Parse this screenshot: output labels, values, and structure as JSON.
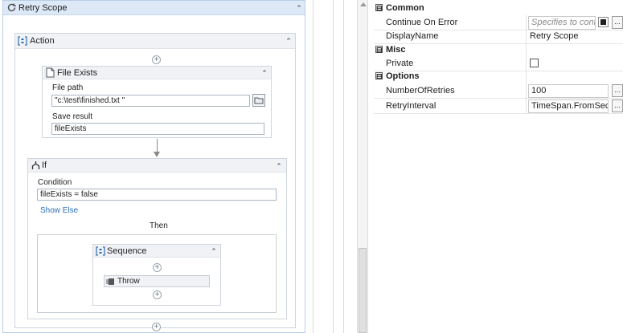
{
  "retry_scope": {
    "title": "Retry Scope",
    "collapse_glyph": "⌃"
  },
  "action": {
    "title": "Action",
    "collapse_glyph": "⌃"
  },
  "file_exists": {
    "title": "File Exists",
    "path_label": "File path",
    "path_value": "\"c:\\test\\finished.txt \"",
    "result_label": "Save result",
    "result_value": "fileExists",
    "collapse_glyph": "⌃"
  },
  "if": {
    "title": "If",
    "condition_label": "Condition",
    "condition_value": "fileExists = false",
    "show_else": "Show Else",
    "then_label": "Then",
    "collapse_glyph": "⌃"
  },
  "sequence": {
    "title": "Sequence",
    "collapse_glyph": "⌃"
  },
  "throw": {
    "label": "Throw"
  },
  "plus_glyph": "+",
  "properties": {
    "groups": [
      {
        "name": "Common",
        "toggle": "⊟"
      },
      {
        "name": "Misc",
        "toggle": "⊟"
      },
      {
        "name": "Options",
        "toggle": "⊟"
      }
    ],
    "continue_on_error": {
      "name": "Continue On Error",
      "placeholder": "Specifies to continu"
    },
    "display_name": {
      "name": "DisplayName",
      "value": "Retry Scope"
    },
    "private": {
      "name": "Private"
    },
    "number_of_retries": {
      "name": "NumberOfRetries",
      "value": "100"
    },
    "retry_interval": {
      "name": "RetryInterval",
      "value": "TimeSpan.FromSecond"
    },
    "ellipsis": "..."
  }
}
